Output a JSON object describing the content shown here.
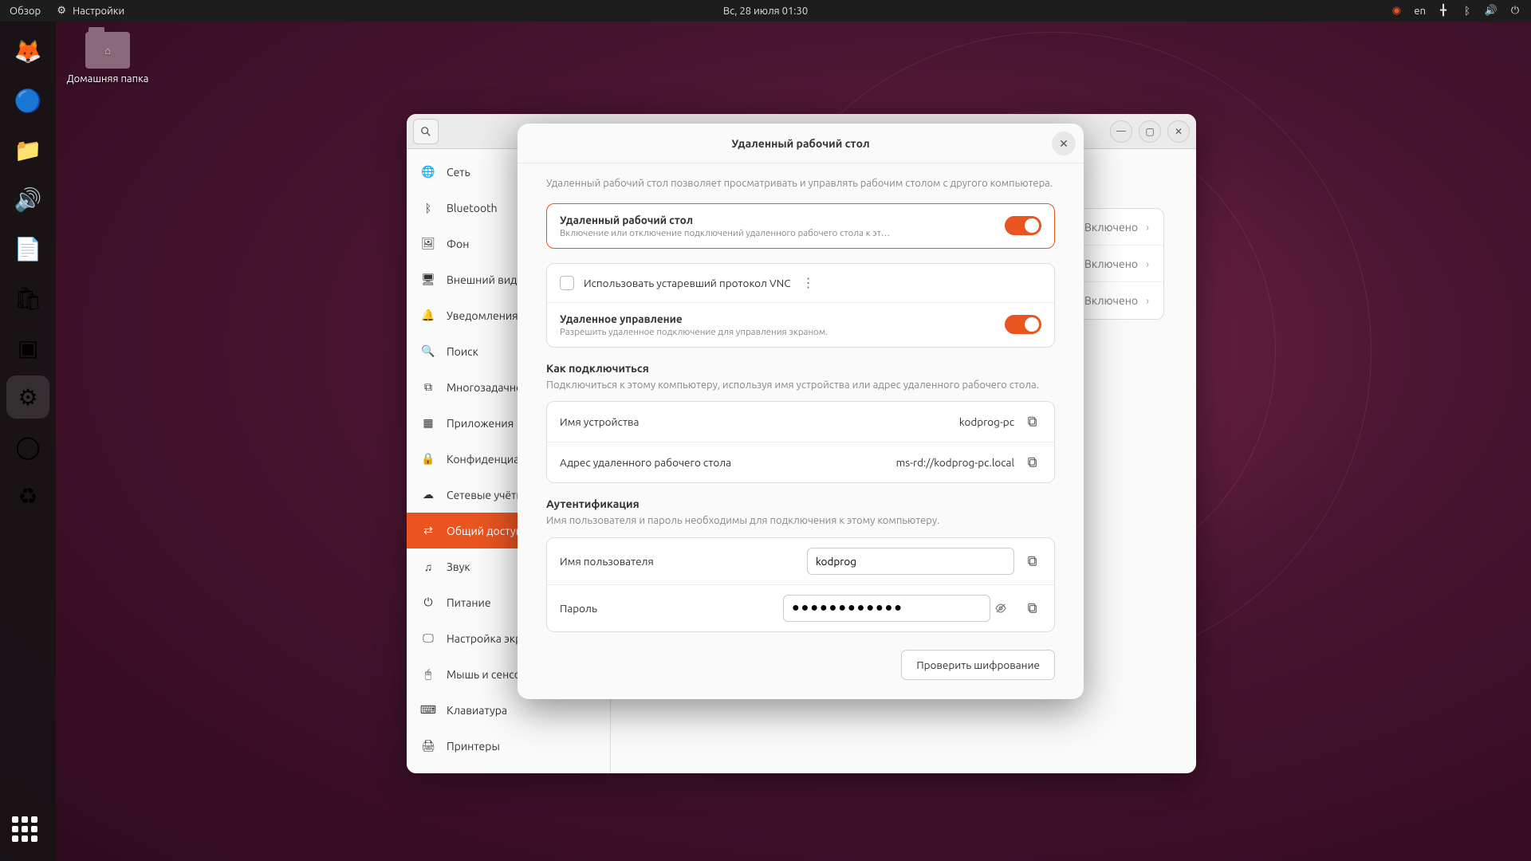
{
  "topbar": {
    "overview": "Обзор",
    "app_name": "Настройки",
    "datetime": "Вс, 28 июля  01:30",
    "lang": "en"
  },
  "desktop": {
    "home_folder": "Домашняя папка"
  },
  "settings": {
    "title": "Настройки",
    "sidebar": [
      {
        "icon": "🌐",
        "label": "Сеть"
      },
      {
        "icon": "ᛒ",
        "label": "Bluetooth"
      },
      {
        "icon": "🖼",
        "label": "Фон"
      },
      {
        "icon": "🖥",
        "label": "Внешний вид"
      },
      {
        "icon": "🔔",
        "label": "Уведомления"
      },
      {
        "icon": "🔍",
        "label": "Поиск"
      },
      {
        "icon": "⧉",
        "label": "Многозадачность"
      },
      {
        "icon": "▦",
        "label": "Приложения"
      },
      {
        "icon": "🔒",
        "label": "Конфиденциальность"
      },
      {
        "icon": "☁",
        "label": "Сетевые учётные записи"
      },
      {
        "icon": "⇄",
        "label": "Общий доступ"
      },
      {
        "icon": "♫",
        "label": "Звук"
      },
      {
        "icon": "⏻",
        "label": "Питание"
      },
      {
        "icon": "🖵",
        "label": "Настройка экрана"
      },
      {
        "icon": "🖱",
        "label": "Мышь и сенсорная панель"
      },
      {
        "icon": "⌨",
        "label": "Клавиатура"
      },
      {
        "icon": "🖨",
        "label": "Принтеры"
      }
    ],
    "content_rows": [
      {
        "value": "Включено"
      },
      {
        "value": "Включено"
      },
      {
        "value": "Включено"
      }
    ]
  },
  "modal": {
    "title": "Удаленный рабочий стол",
    "intro": "Удаленный рабочий стол позволяет просматривать и управлять рабочим столом с другого компьютера.",
    "rd_toggle_title": "Удаленный рабочий стол",
    "rd_toggle_sub": "Включение или отключение подключений удаленного рабочего стола к этому …",
    "vnc_label": "Использовать устаревший протокол VNC",
    "rc_title": "Удаленное управление",
    "rc_sub": "Разрешить удаленное подключение для управления экраном.",
    "howto_title": "Как подключиться",
    "howto_desc": "Подключиться к этому компьютеру, используя имя устройства или адрес удаленного рабочего стола.",
    "device_name_label": "Имя устройства",
    "device_name_value": "kodprog-pc",
    "address_label": "Адрес удаленного рабочего стола",
    "address_value": "ms-rd://kodprog-pc.local",
    "auth_title": "Аутентификация",
    "auth_desc": "Имя пользователя и пароль необходимы для подключения к этому компьютеру.",
    "username_label": "Имя пользователя",
    "username_value": "kodprog",
    "password_label": "Пароль",
    "password_value": "●●●●●●●●●●●●",
    "verify_btn": "Проверить шифрование"
  }
}
